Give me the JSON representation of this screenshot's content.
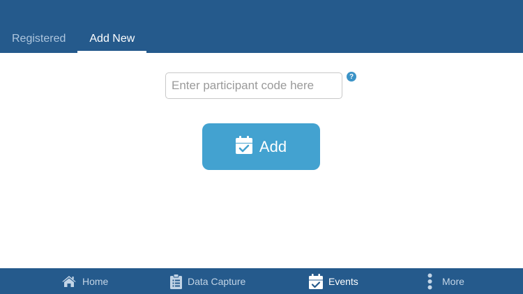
{
  "tabs": [
    {
      "label": "Registered",
      "active": false
    },
    {
      "label": "Add New",
      "active": true
    }
  ],
  "form": {
    "placeholder": "Enter participant code here",
    "value": "",
    "help_glyph": "?",
    "add_label": "Add"
  },
  "nav": {
    "items": [
      {
        "label": "Home",
        "icon": "home-icon",
        "active": false
      },
      {
        "label": "Data Capture",
        "icon": "clipboard-list-icon",
        "active": false
      },
      {
        "label": "Events",
        "icon": "calendar-check-icon",
        "active": true
      },
      {
        "label": "More",
        "icon": "more-vertical-icon",
        "active": false
      }
    ]
  },
  "colors": {
    "header": "#255a8c",
    "accent_button": "#43a2d0",
    "help_icon": "#3b93c7",
    "inactive_tab": "#aec6de",
    "active": "#ffffff"
  }
}
